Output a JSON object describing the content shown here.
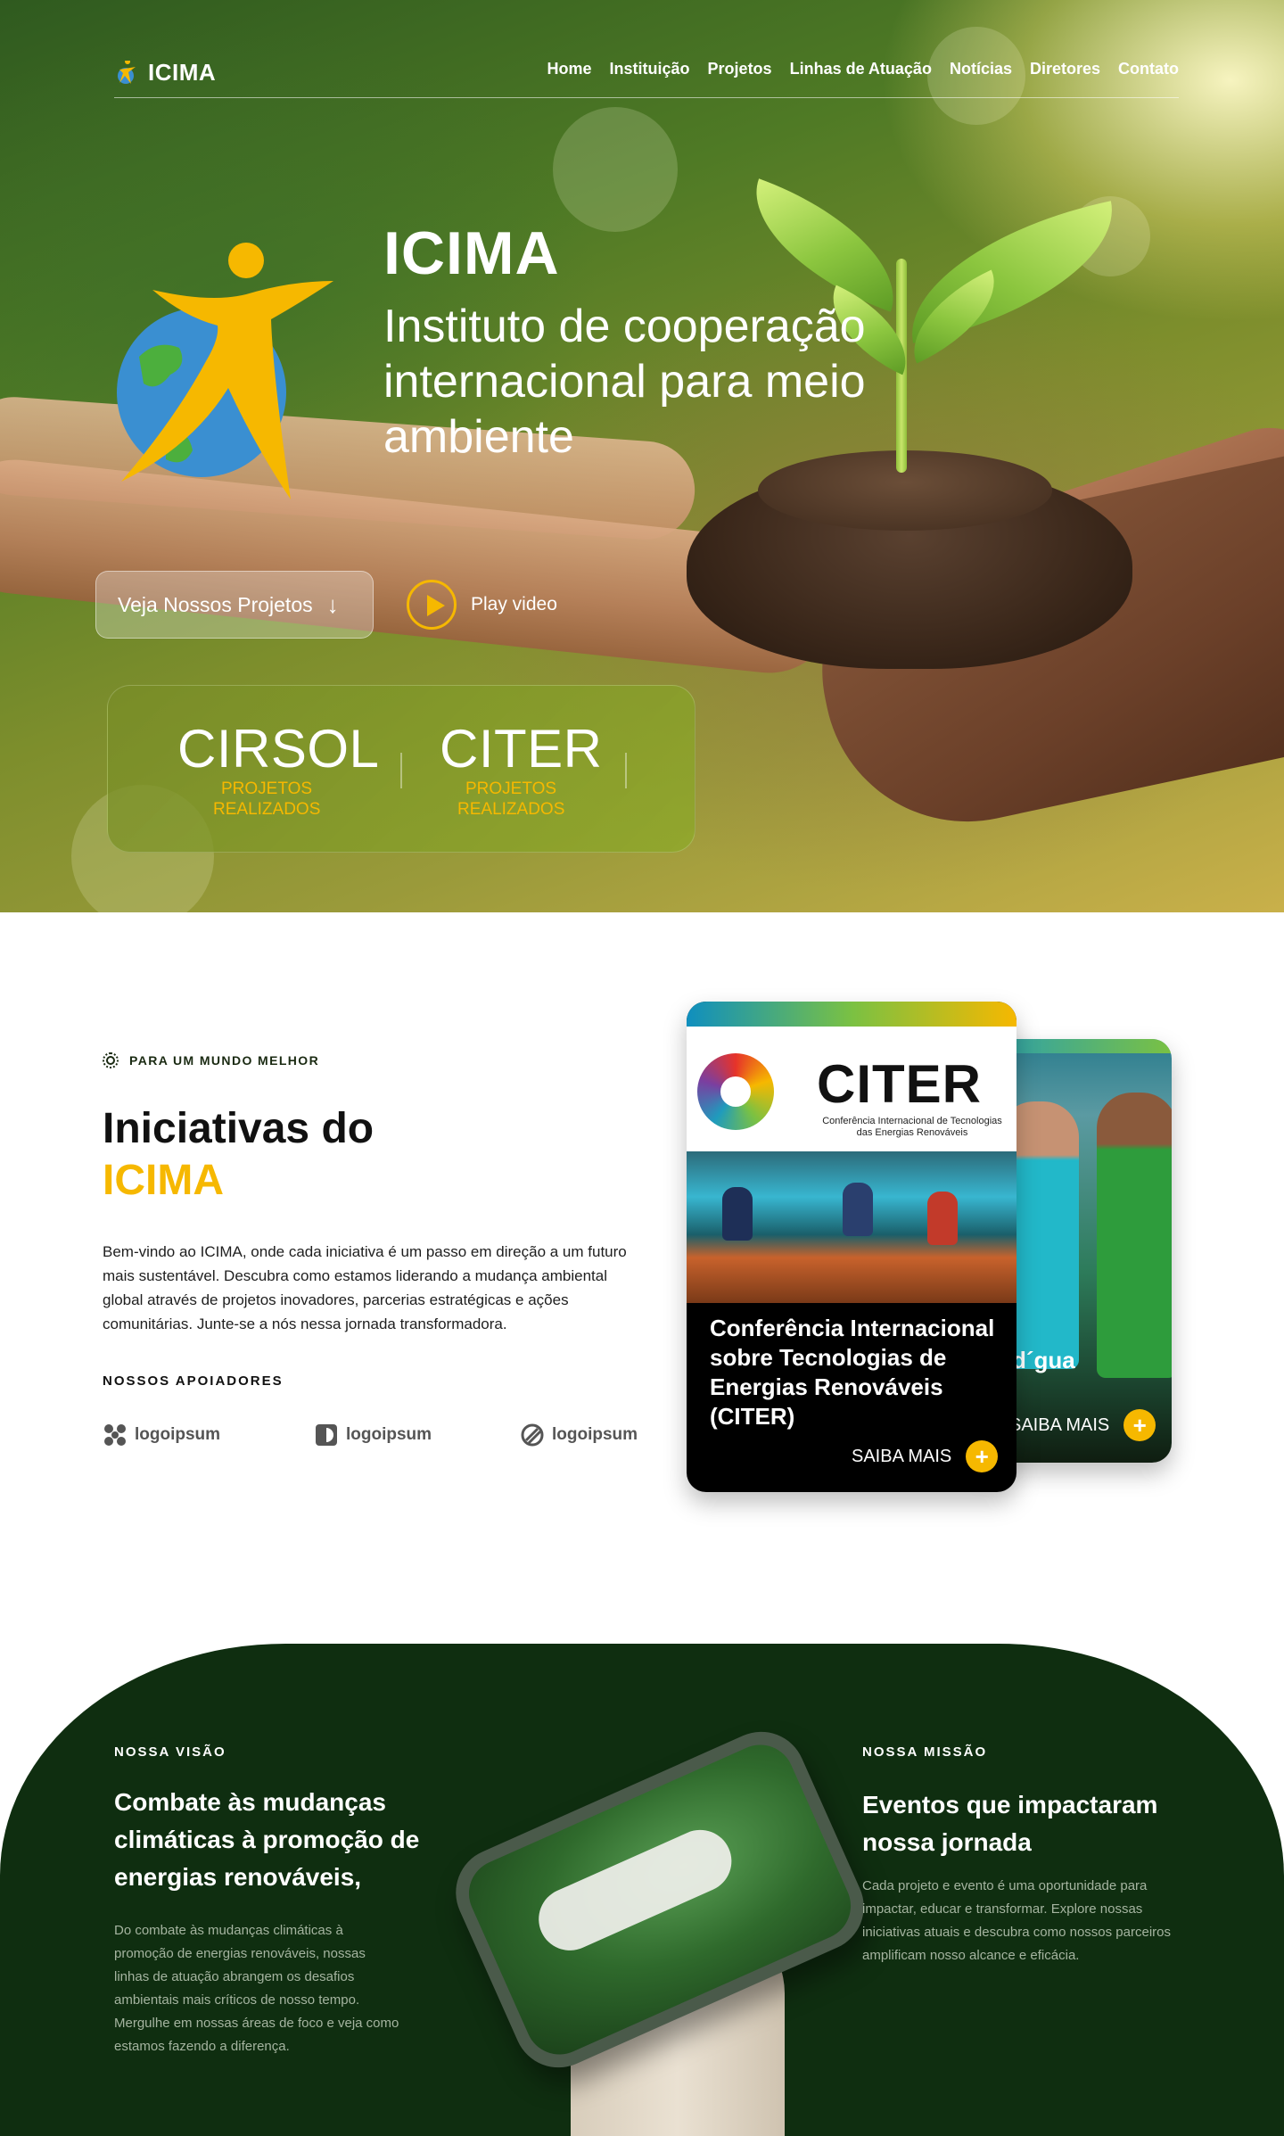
{
  "nav": {
    "brand": "ICIMA",
    "items": [
      "Home",
      "Instituição",
      "Projetos",
      "Linhas de Atuação",
      "Notícias",
      "Diretores",
      "Contato"
    ]
  },
  "hero": {
    "title": "ICIMA",
    "subtitle": "Instituto de cooperação internacional para meio ambiente",
    "projects_button": "Veja Nossos Projetos",
    "play_label": "Play video",
    "stats": [
      {
        "name": "CIRSOL",
        "label": "PROJETOS REALIZADOS"
      },
      {
        "name": "CITER",
        "label": "PROJETOS REALIZADOS"
      }
    ]
  },
  "initiatives": {
    "eyebrow": "PARA UM MUNDO MELHOR",
    "title": "Iniciativas do",
    "title_accent": "ICIMA",
    "body": "Bem-vindo ao ICIMA, onde cada iniciativa é um passo em direção a um futuro mais sustentável. Descubra como estamos liderando a mudança ambiental global através de projetos inovadores, parcerias estratégicas e ações comunitárias. Junte-se a nós nessa jornada transformadora.",
    "supporters_title": "NOSSOS APOIADORES",
    "supporters": [
      "logoipsum",
      "logoipsum",
      "logoipsum"
    ]
  },
  "cards": {
    "front": {
      "logo_word": "CITER",
      "logo_caption": "Conferência Internacional de Tecnologias das Energias Renováveis",
      "title": "Conferência Internacional sobre Tecnologias de Energias Renováveis (CITER)",
      "cta": "SAIBA MAIS"
    },
    "back": {
      "title": "d´gua",
      "cta": "SAIBA MAIS"
    }
  },
  "vision": {
    "label": "NOSSA VISÃO",
    "title": "Combate às mudanças climáticas à promoção de energias renováveis,",
    "body": "Do combate às mudanças climáticas à promoção de energias renováveis, nossas linhas de atuação abrangem os desafios ambientais mais críticos de nosso tempo. Mergulhe em nossas áreas de foco e veja como estamos fazendo a diferença."
  },
  "mission": {
    "label": "NOSSA MISSÃO",
    "title": "Eventos que impactaram nossa jornada",
    "body": "Cada projeto e evento é uma oportunidade para impactar, educar e transformar. Explore nossas iniciativas atuais e descubra como nossos parceiros amplificam nosso alcance e eficácia."
  },
  "colors": {
    "accent": "#f6b800",
    "dark_green": "#0f2e10"
  },
  "icons": {
    "scroll": "arrow-down-icon",
    "play": "play-icon",
    "eyebrow": "sun-icon",
    "cta": "plus-icon"
  }
}
